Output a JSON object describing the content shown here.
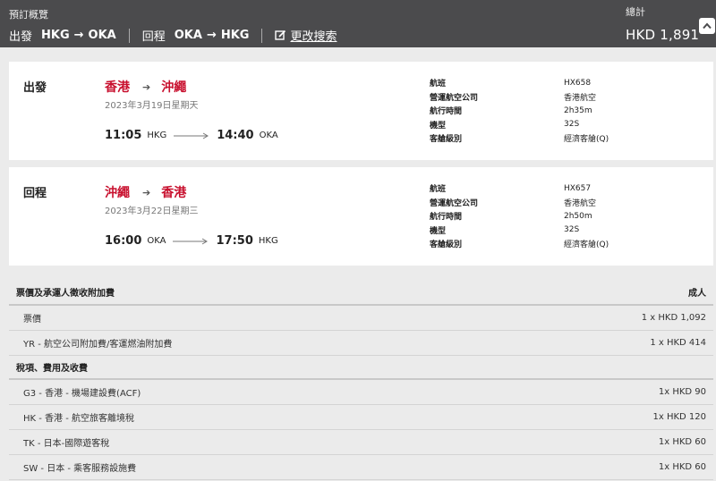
{
  "header": {
    "overview_label": "預訂概覽",
    "outbound_label": "出發",
    "outbound_from": "HKG",
    "outbound_to": "OKA",
    "return_label": "回程",
    "return_from": "OKA",
    "return_to": "HKG",
    "edit_search_label": "更改搜索",
    "total_label": "總計",
    "total_amount": "HKD 1,891"
  },
  "outbound": {
    "direction": "出發",
    "from_city": "香港",
    "to_city": "沖繩",
    "date": "2023年3月19日星期天",
    "dep_time": "11:05",
    "dep_airport": "HKG",
    "arr_time": "14:40",
    "arr_airport": "OKA",
    "details": [
      {
        "k": "航班",
        "v": "HX658"
      },
      {
        "k": "營運航空公司",
        "v": "香港航空"
      },
      {
        "k": "航行時間",
        "v": "2h35m"
      },
      {
        "k": "機型",
        "v": "32S"
      },
      {
        "k": "客艙級別",
        "v": "經濟客艙(Q)"
      }
    ]
  },
  "return": {
    "direction": "回程",
    "from_city": "沖繩",
    "to_city": "香港",
    "date": "2023年3月22日星期三",
    "dep_time": "16:00",
    "dep_airport": "OKA",
    "arr_time": "17:50",
    "arr_airport": "HKG",
    "details": [
      {
        "k": "航班",
        "v": "HX657"
      },
      {
        "k": "營運航空公司",
        "v": "香港航空"
      },
      {
        "k": "航行時間",
        "v": "2h50m"
      },
      {
        "k": "機型",
        "v": "32S"
      },
      {
        "k": "客艙級別",
        "v": "經濟客艙(Q)"
      }
    ]
  },
  "fares": {
    "section_title": "票價及承運人徵收附加費",
    "passenger_type": "成人",
    "items": [
      {
        "label": "票價",
        "amount": "1 x HKD 1,092"
      },
      {
        "label": "YR - 航空公司附加費/客運燃油附加費",
        "amount": "1 x HKD 414"
      }
    ],
    "tax_title": "稅項、費用及收費",
    "taxes": [
      {
        "label": "G3 - 香港 - 機場建設費(ACF)",
        "amount": "1x HKD 90"
      },
      {
        "label": "HK - 香港 - 航空旅客離境稅",
        "amount": "1x HKD 120"
      },
      {
        "label": "TK - 日本-國際遊客稅",
        "amount": "1x HKD 60"
      },
      {
        "label": "SW - 日本 - 乘客服務設施費",
        "amount": "1x HKD 60"
      }
    ]
  },
  "colors": {
    "header_bg": "#4b4b4d",
    "accent_red": "#c8102e",
    "page_bg": "#ebebeb"
  }
}
